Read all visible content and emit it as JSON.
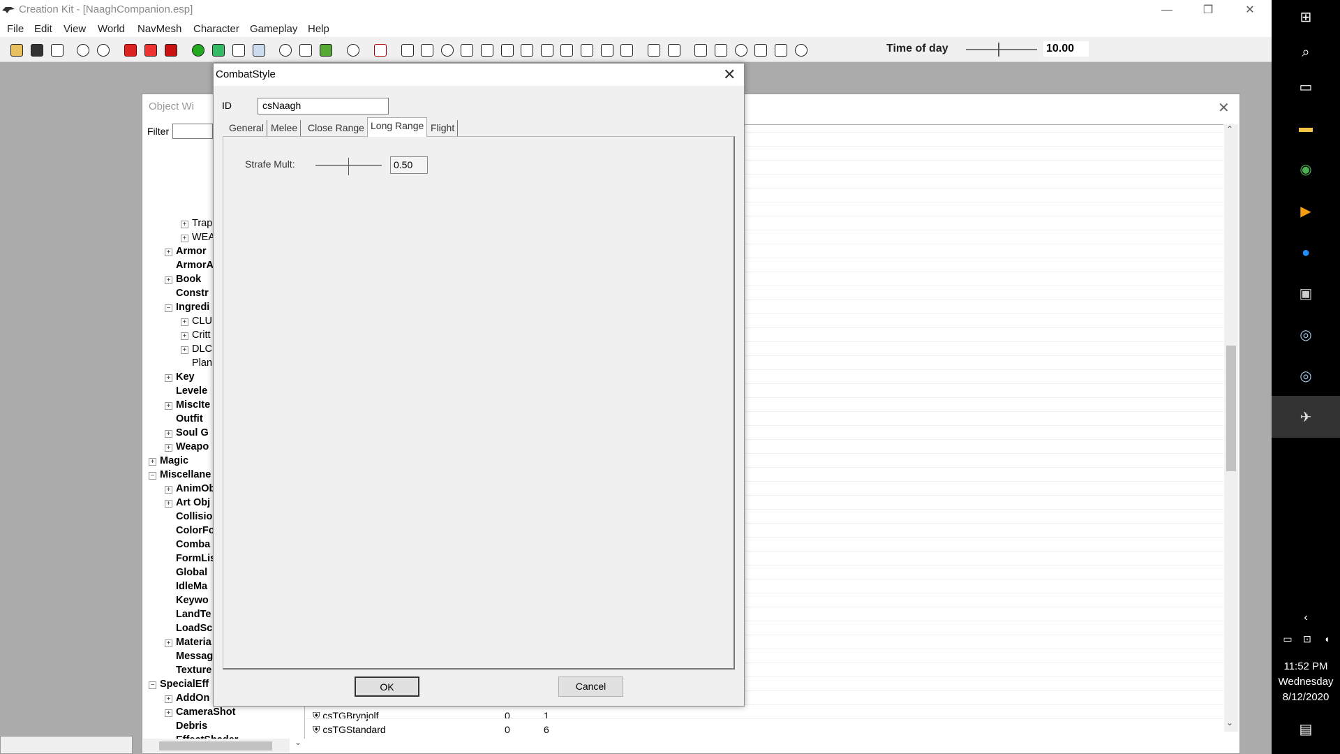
{
  "window": {
    "title": "Creation Kit - [NaaghCompanion.esp]"
  },
  "menu": [
    "File",
    "Edit",
    "View",
    "World",
    "NavMesh",
    "Character",
    "Gameplay",
    "Help"
  ],
  "toolbar": {
    "time_of_day_label": "Time of day",
    "time_of_day_value": "10.00"
  },
  "object_window": {
    "title": "Object Wi",
    "filter_label": "Filter",
    "tree": [
      {
        "label": "Trap",
        "bold": false,
        "expander": "+"
      },
      {
        "label": "WEA",
        "bold": false,
        "expander": "+"
      },
      {
        "label": "Armor",
        "bold": true,
        "expander": "+"
      },
      {
        "label": "ArmorA",
        "bold": true,
        "expander": ""
      },
      {
        "label": "Book",
        "bold": true,
        "expander": "+"
      },
      {
        "label": "Constr",
        "bold": true,
        "expander": ""
      },
      {
        "label": "Ingredi",
        "bold": true,
        "expander": "−"
      },
      {
        "label": "CLU",
        "bold": false,
        "expander": "+"
      },
      {
        "label": "Critt",
        "bold": false,
        "expander": "+"
      },
      {
        "label": "DLC",
        "bold": false,
        "expander": "+"
      },
      {
        "label": "Plan",
        "bold": false,
        "expander": ""
      },
      {
        "label": "Key",
        "bold": true,
        "expander": "+"
      },
      {
        "label": "Levele",
        "bold": true,
        "expander": ""
      },
      {
        "label": "MiscIte",
        "bold": true,
        "expander": "+"
      },
      {
        "label": "Outfit",
        "bold": true,
        "expander": ""
      },
      {
        "label": "Soul G",
        "bold": true,
        "expander": "+"
      },
      {
        "label": "Weapo",
        "bold": true,
        "expander": "+"
      },
      {
        "label": "Magic",
        "bold": true,
        "expander": "+"
      },
      {
        "label": "Miscellane",
        "bold": true,
        "expander": "−"
      },
      {
        "label": "AnimOb",
        "bold": true,
        "expander": "+"
      },
      {
        "label": "Art Obj",
        "bold": true,
        "expander": "+"
      },
      {
        "label": "Collisio",
        "bold": true,
        "expander": ""
      },
      {
        "label": "ColorFo",
        "bold": true,
        "expander": ""
      },
      {
        "label": "Comba",
        "bold": true,
        "expander": ""
      },
      {
        "label": "FormLis",
        "bold": true,
        "expander": ""
      },
      {
        "label": "Global",
        "bold": true,
        "expander": ""
      },
      {
        "label": "IdleMa",
        "bold": true,
        "expander": ""
      },
      {
        "label": "Keywo",
        "bold": true,
        "expander": ""
      },
      {
        "label": "LandTe",
        "bold": true,
        "expander": ""
      },
      {
        "label": "LoadSc",
        "bold": true,
        "expander": ""
      },
      {
        "label": "Materia",
        "bold": true,
        "expander": "+"
      },
      {
        "label": "Messag",
        "bold": true,
        "expander": ""
      },
      {
        "label": "Texture",
        "bold": true,
        "expander": ""
      },
      {
        "label": "SpecialEff",
        "bold": true,
        "expander": "−"
      },
      {
        "label": "AddOn",
        "bold": true,
        "expander": "+"
      },
      {
        "label": "CameraShot",
        "bold": true,
        "expander": "+"
      },
      {
        "label": "Debris",
        "bold": true,
        "expander": ""
      },
      {
        "label": "EffectShader",
        "bold": true,
        "expander": ""
      }
    ],
    "list_rows": [
      {
        "name": "csTGBrynjolf",
        "col2": "0",
        "col3": "1"
      },
      {
        "name": "csTGStandard",
        "col2": "0",
        "col3": "6"
      }
    ]
  },
  "dialog": {
    "title": "CombatStyle",
    "id_label": "ID",
    "id_value": "csNaagh",
    "tabs": [
      "General",
      "Melee",
      "Close Range",
      "Long Range",
      "Flight"
    ],
    "active_tab": "Long Range",
    "strafe_mult_label": "Strafe Mult:",
    "strafe_mult_value": "0.50",
    "ok_label": "OK",
    "cancel_label": "Cancel"
  },
  "taskbar": {
    "time": "11:52 PM",
    "day": "Wednesday",
    "date": "8/12/2020"
  }
}
